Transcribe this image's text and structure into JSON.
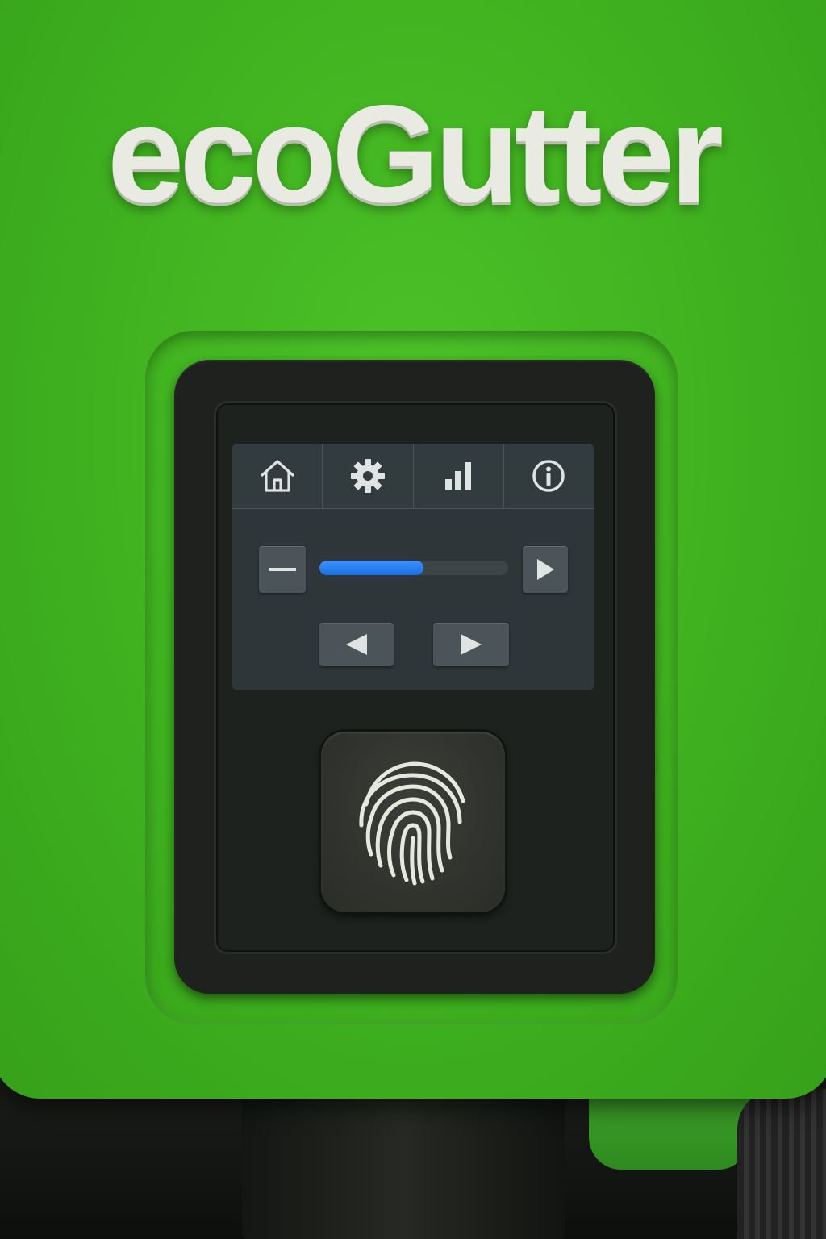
{
  "brand": {
    "name": "ecoGutter"
  },
  "nav": {
    "items": [
      {
        "icon": "home-icon"
      },
      {
        "icon": "gear-icon"
      },
      {
        "icon": "signal-bars-icon"
      },
      {
        "icon": "info-icon"
      }
    ]
  },
  "controls": {
    "minus_icon": "minus-icon",
    "slider_value_fraction": 0.55,
    "step_icon": "play-right-icon",
    "prev_icon": "arrow-left-icon",
    "next_icon": "arrow-right-icon"
  },
  "fingerprint": {
    "icon": "fingerprint-icon"
  },
  "colors": {
    "housing": "#3fb11f",
    "accent": "#1a6fe0",
    "logo_text": "#e9ebe2",
    "icon": "#dfe3e4"
  }
}
